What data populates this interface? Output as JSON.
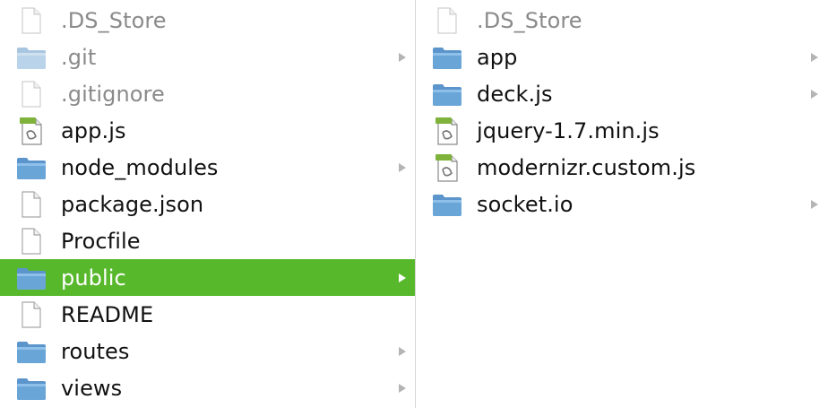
{
  "columns": [
    {
      "items": [
        {
          "name": ".DS_Store",
          "type": "file",
          "hidden": true,
          "has_children": false,
          "selected": false
        },
        {
          "name": ".git",
          "type": "folder",
          "hidden": true,
          "has_children": true,
          "selected": false
        },
        {
          "name": ".gitignore",
          "type": "file",
          "hidden": true,
          "has_children": false,
          "selected": false
        },
        {
          "name": "app.js",
          "type": "script",
          "hidden": false,
          "has_children": false,
          "selected": false
        },
        {
          "name": "node_modules",
          "type": "folder",
          "hidden": false,
          "has_children": true,
          "selected": false
        },
        {
          "name": "package.json",
          "type": "file",
          "hidden": false,
          "has_children": false,
          "selected": false
        },
        {
          "name": "Procfile",
          "type": "file",
          "hidden": false,
          "has_children": false,
          "selected": false
        },
        {
          "name": "public",
          "type": "folder",
          "hidden": false,
          "has_children": true,
          "selected": true
        },
        {
          "name": "README",
          "type": "file",
          "hidden": false,
          "has_children": false,
          "selected": false
        },
        {
          "name": "routes",
          "type": "folder",
          "hidden": false,
          "has_children": true,
          "selected": false
        },
        {
          "name": "views",
          "type": "folder",
          "hidden": false,
          "has_children": true,
          "selected": false
        }
      ]
    },
    {
      "items": [
        {
          "name": ".DS_Store",
          "type": "file",
          "hidden": true,
          "has_children": false,
          "selected": false
        },
        {
          "name": "app",
          "type": "folder",
          "hidden": false,
          "has_children": true,
          "selected": false
        },
        {
          "name": "deck.js",
          "type": "folder",
          "hidden": false,
          "has_children": true,
          "selected": false
        },
        {
          "name": "jquery-1.7.min.js",
          "type": "script",
          "hidden": false,
          "has_children": false,
          "selected": false
        },
        {
          "name": "modernizr.custom.js",
          "type": "script",
          "hidden": false,
          "has_children": false,
          "selected": false
        },
        {
          "name": "socket.io",
          "type": "folder",
          "hidden": false,
          "has_children": true,
          "selected": false
        }
      ]
    }
  ],
  "colors": {
    "selection": "#58b82c",
    "folder": "#6aa5d8",
    "hidden_text": "#8a8a8a",
    "text": "#111111"
  },
  "icons": {
    "file": "document-icon",
    "folder": "folder-icon",
    "script": "script-document-icon"
  }
}
